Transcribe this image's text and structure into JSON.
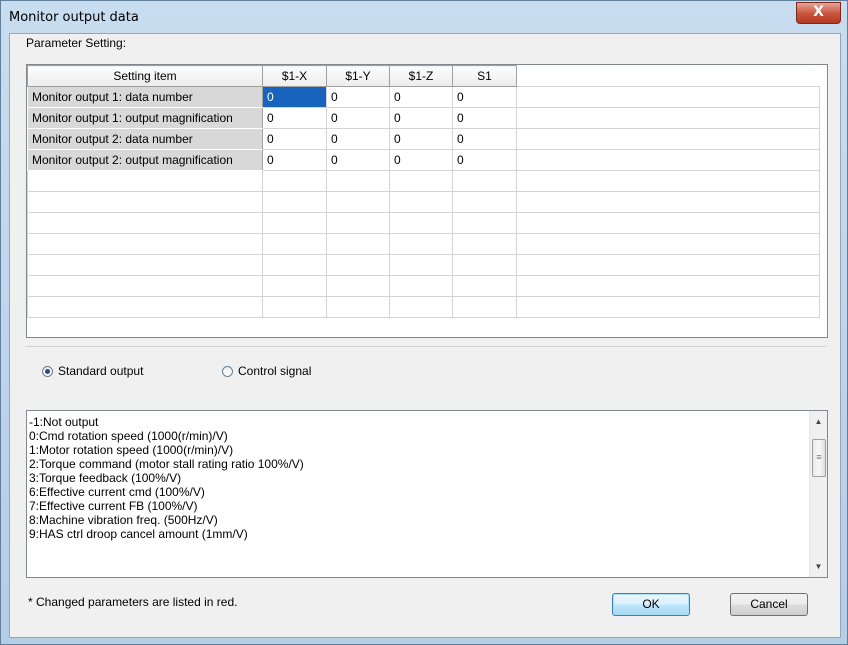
{
  "window": {
    "title": "Monitor output data",
    "close_glyph": "X"
  },
  "parameter_setting_label": "Parameter Setting:",
  "table": {
    "headers": [
      "Setting item",
      "$1-X",
      "$1-Y",
      "$1-Z",
      "S1"
    ],
    "rows": [
      {
        "label": "Monitor output 1: data number",
        "values": [
          "0",
          "0",
          "0",
          "0"
        ]
      },
      {
        "label": "Monitor output 1: output magnification",
        "values": [
          "0",
          "0",
          "0",
          "0"
        ]
      },
      {
        "label": "Monitor output 2: data number",
        "values": [
          "0",
          "0",
          "0",
          "0"
        ]
      },
      {
        "label": "Monitor output 2: output magnification",
        "values": [
          "0",
          "0",
          "0",
          "0"
        ]
      }
    ]
  },
  "radios": {
    "standard_output": "Standard output",
    "control_signal": "Control signal",
    "selected": "standard_output"
  },
  "list": {
    "items": [
      "-1:Not output",
      "0:Cmd rotation speed (1000(r/min)/V)",
      "1:Motor rotation speed (1000(r/min)/V)",
      "2:Torque command (motor stall rating ratio 100%/V)",
      "3:Torque feedback (100%/V)",
      "6:Effective current cmd (100%/V)",
      "7:Effective current FB (100%/V)",
      "8:Machine vibration freq. (500Hz/V)",
      "9:HAS ctrl droop cancel amount (1mm/V)"
    ]
  },
  "footnote": "* Changed parameters are listed in red.",
  "buttons": {
    "ok": "OK",
    "cancel": "Cancel"
  },
  "colors": {
    "selection": "#1863be",
    "title_bar": "#c9ddf0",
    "close_button": "#c9513a"
  }
}
